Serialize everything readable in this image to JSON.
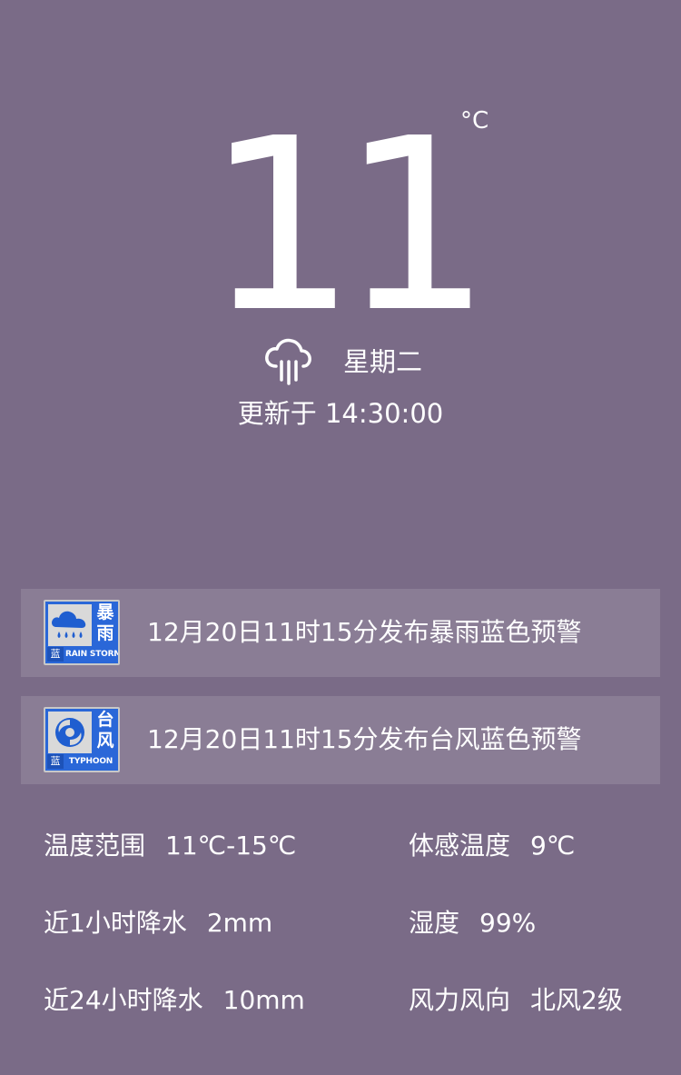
{
  "current": {
    "temperature": "11",
    "unit": "°C",
    "weather_icon": "cloud-rain-icon",
    "weekday": "星期二",
    "updated": "更新于 14:30:00"
  },
  "alerts": [
    {
      "badge_icon": "rainstorm-warning-icon",
      "badge_cn": "暴雨",
      "badge_level": "蓝",
      "badge_en": "RAIN STORM",
      "text": "12月20日11时15分发布暴雨蓝色预警"
    },
    {
      "badge_icon": "typhoon-warning-icon",
      "badge_cn": "台风",
      "badge_level": "蓝",
      "badge_en": "TYPHOON",
      "text": "12月20日11时15分发布台风蓝色预警"
    }
  ],
  "stats": {
    "temp_range": {
      "label": "温度范围",
      "value": "11℃-15℃"
    },
    "feels_like": {
      "label": "体感温度",
      "value": "9℃"
    },
    "precip_1h": {
      "label": "近1小时降水",
      "value": "2mm"
    },
    "humidity": {
      "label": "湿度",
      "value": "99%"
    },
    "precip_24h": {
      "label": "近24小时降水",
      "value": "10mm"
    },
    "wind": {
      "label": "风力风向",
      "value": "北风2级"
    }
  },
  "colors": {
    "background": "#7a6b87",
    "alert_background": "rgba(255,255,255,0.12)",
    "badge_blue": "#2a67d8",
    "text": "#ffffff"
  }
}
